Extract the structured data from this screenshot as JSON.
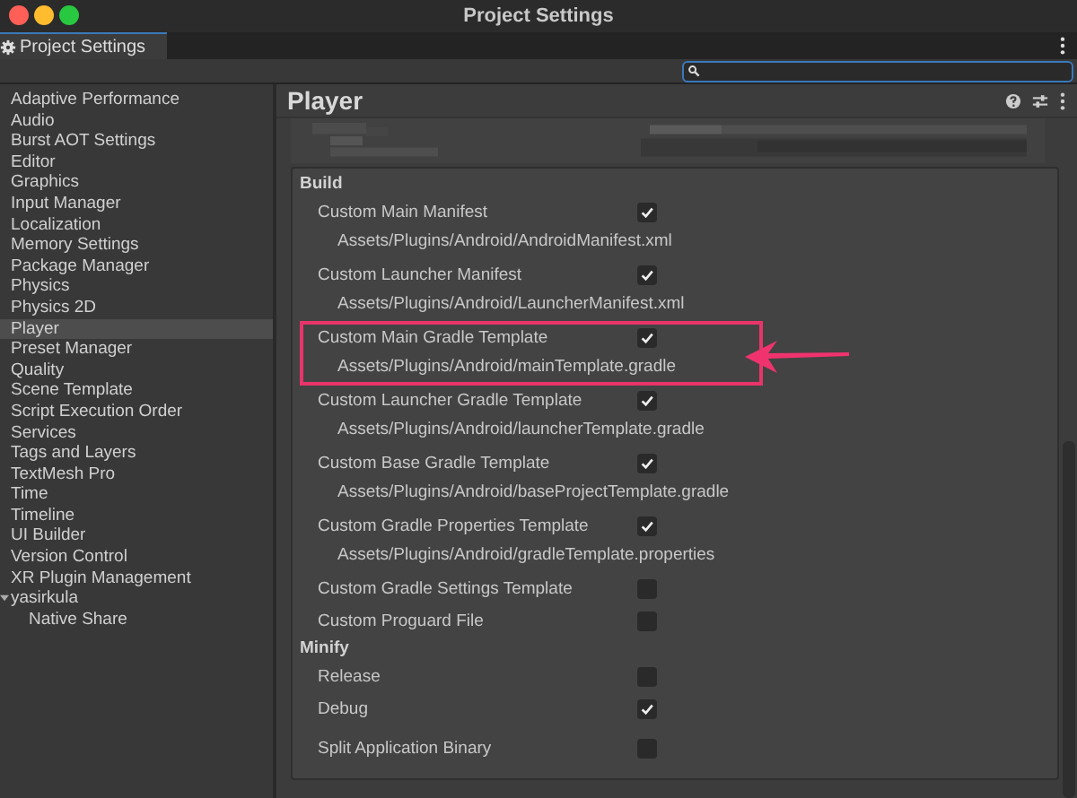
{
  "window": {
    "title": "Project Settings"
  },
  "tabs": [
    {
      "label": "Project Settings",
      "selected": true
    }
  ],
  "sidebar": {
    "items": [
      {
        "label": "Adaptive Performance",
        "selected": false
      },
      {
        "label": "Audio",
        "selected": false
      },
      {
        "label": "Burst AOT Settings",
        "selected": false
      },
      {
        "label": "Editor",
        "selected": false
      },
      {
        "label": "Graphics",
        "selected": false
      },
      {
        "label": "Input Manager",
        "selected": false
      },
      {
        "label": "Localization",
        "selected": false
      },
      {
        "label": "Memory Settings",
        "selected": false
      },
      {
        "label": "Package Manager",
        "selected": false
      },
      {
        "label": "Physics",
        "selected": false
      },
      {
        "label": "Physics 2D",
        "selected": false
      },
      {
        "label": "Player",
        "selected": true
      },
      {
        "label": "Preset Manager",
        "selected": false
      },
      {
        "label": "Quality",
        "selected": false
      },
      {
        "label": "Scene Template",
        "selected": false
      },
      {
        "label": "Script Execution Order",
        "selected": false
      },
      {
        "label": "Services",
        "selected": false
      },
      {
        "label": "Tags and Layers",
        "selected": false
      },
      {
        "label": "TextMesh Pro",
        "selected": false
      },
      {
        "label": "Time",
        "selected": false
      },
      {
        "label": "Timeline",
        "selected": false
      },
      {
        "label": "UI Builder",
        "selected": false
      },
      {
        "label": "Version Control",
        "selected": false
      },
      {
        "label": "XR Plugin Management",
        "selected": false
      },
      {
        "label": "yasirkula",
        "selected": false,
        "expanded": true,
        "children": [
          {
            "label": "Native Share",
            "selected": false
          }
        ]
      }
    ]
  },
  "inspector": {
    "title": "Player",
    "sections": [
      {
        "heading": "Build",
        "rows": [
          {
            "label": "Custom Main Manifest",
            "checked": true,
            "path": "Assets/Plugins/Android/AndroidManifest.xml",
            "highlighted": false
          },
          {
            "label": "Custom Launcher Manifest",
            "checked": true,
            "path": "Assets/Plugins/Android/LauncherManifest.xml",
            "highlighted": false
          },
          {
            "label": "Custom Main Gradle Template",
            "checked": true,
            "path": "Assets/Plugins/Android/mainTemplate.gradle",
            "highlighted": true
          },
          {
            "label": "Custom Launcher Gradle Template",
            "checked": true,
            "path": "Assets/Plugins/Android/launcherTemplate.gradle",
            "highlighted": false
          },
          {
            "label": "Custom Base Gradle Template",
            "checked": true,
            "path": "Assets/Plugins/Android/baseProjectTemplate.gradle",
            "highlighted": false
          },
          {
            "label": "Custom Gradle Properties Template",
            "checked": true,
            "path": "Assets/Plugins/Android/gradleTemplate.properties",
            "highlighted": false
          },
          {
            "label": "Custom Gradle Settings Template",
            "checked": false,
            "highlighted": false
          },
          {
            "label": "Custom Proguard File",
            "checked": false,
            "highlighted": false
          }
        ]
      },
      {
        "heading": "Minify",
        "rows": [
          {
            "label": "Release",
            "checked": false,
            "highlighted": false
          },
          {
            "label": "Debug",
            "checked": true,
            "highlighted": false
          }
        ]
      }
    ],
    "rows_after": [
      {
        "label": "Split Application Binary",
        "checked": false,
        "highlighted": false
      }
    ]
  }
}
